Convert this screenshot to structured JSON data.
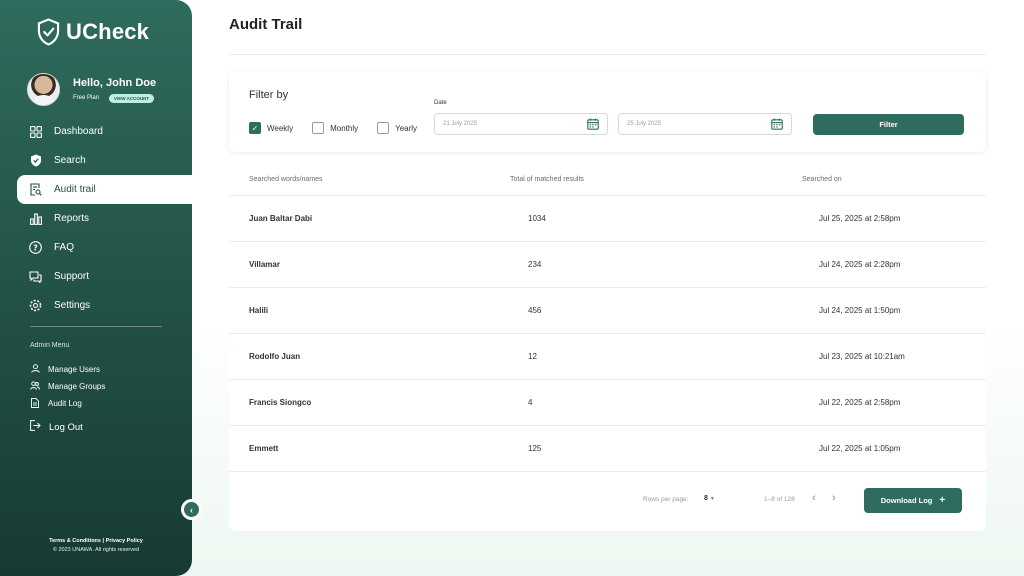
{
  "app": {
    "name": "UCheck"
  },
  "user": {
    "greeting": "Hello, John Doe",
    "plan": "Free Plan",
    "view_account": "VIEW ACCOUNT"
  },
  "nav": [
    {
      "label": "Dashboard",
      "icon": "grid-icon"
    },
    {
      "label": "Search",
      "icon": "shield-check-icon"
    },
    {
      "label": "Audit trail",
      "icon": "document-search-icon",
      "active": true
    },
    {
      "label": "Reports",
      "icon": "bar-chart-icon"
    },
    {
      "label": "FAQ",
      "icon": "question-icon"
    },
    {
      "label": "Support",
      "icon": "chat-icon"
    },
    {
      "label": "Settings",
      "icon": "gear-icon"
    }
  ],
  "admin": {
    "label": "Admin Menu",
    "items": [
      {
        "label": "Manage Users",
        "icon": "user-icon"
      },
      {
        "label": "Manage Groups",
        "icon": "users-icon"
      },
      {
        "label": "Audit Log",
        "icon": "file-icon"
      }
    ],
    "logout": "Log Out"
  },
  "footer": {
    "links": "Terms & Conditions  |  Privacy Policy",
    "copyright": "© 2023 UNAWA. All rights reserved"
  },
  "page": {
    "title": "Audit Trail"
  },
  "filter": {
    "title": "Filter by",
    "options": [
      {
        "label": "Weekly",
        "checked": true
      },
      {
        "label": "Monthly",
        "checked": false
      },
      {
        "label": "Yearly",
        "checked": false
      }
    ],
    "date_label": "Date",
    "date_from": "21 July 2025",
    "date_to": "25 July 2025",
    "button": "Filter"
  },
  "table": {
    "headers": [
      "Searched words/names",
      "Total of matched results",
      "Searched on"
    ],
    "rows": [
      {
        "name": "Juan Baltar Dabi",
        "count": "1034",
        "date": "Jul 25, 2025 at 2:58pm"
      },
      {
        "name": "Villamar",
        "count": "234",
        "date": "Jul 24, 2025 at 2:28pm"
      },
      {
        "name": "Halili",
        "count": "456",
        "date": "Jul 24, 2025 at 1:50pm"
      },
      {
        "name": "Rodolfo Juan",
        "count": "12",
        "date": "Jul 23, 2025 at 10:21am"
      },
      {
        "name": "Francis Siongco",
        "count": "4",
        "date": "Jul 22, 2025 at 2:58pm"
      },
      {
        "name": "Emmett",
        "count": "125",
        "date": "Jul 22, 2025 at 1:05pm"
      }
    ]
  },
  "pagination": {
    "rows_label": "Rows per page:",
    "rows_value": "8",
    "range": "1–8 of 128"
  },
  "download": {
    "label": "Download Log",
    "icon": "plus-icon"
  },
  "colors": {
    "primary": "#2f6b5e",
    "sidebar_dark": "#173a33"
  }
}
